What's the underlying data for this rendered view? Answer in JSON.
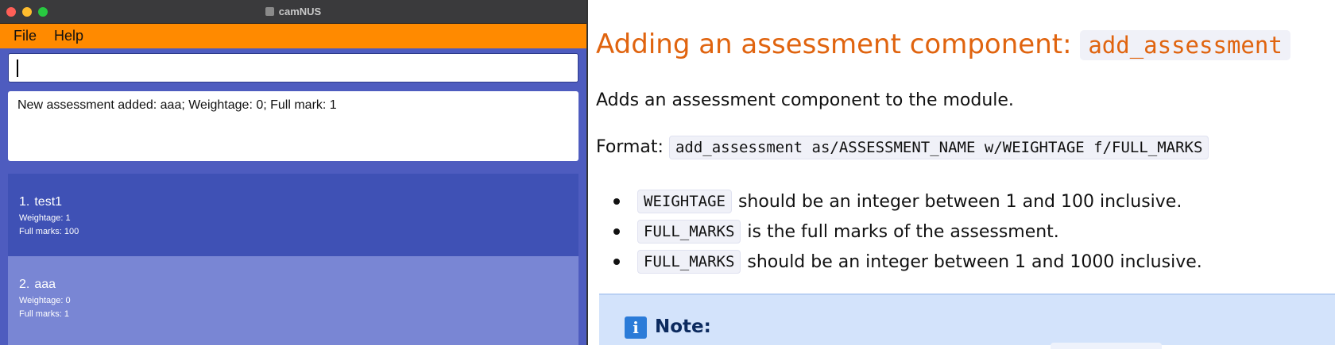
{
  "app": {
    "window_title": "camNUS",
    "menu": [
      "File",
      "Help"
    ],
    "command_input": {
      "value": "",
      "placeholder": ""
    },
    "result_text": "New assessment added: aaa; Weightage: 0; Full mark: 1",
    "assessments": [
      {
        "index": "1.",
        "name": "test1",
        "weightage": "Weightage: 1",
        "full_marks": "Full marks: 100"
      },
      {
        "index": "2.",
        "name": "aaa",
        "weightage": "Weightage: 0",
        "full_marks": "Full marks: 1"
      }
    ],
    "colors": {
      "menubar": "#ff8a00",
      "panel": "#4e5cbf",
      "card_selected": "#3f51b5",
      "card": "#7986d4"
    }
  },
  "doc": {
    "heading_text": "Adding an assessment component: ",
    "heading_code": "add_assessment",
    "description": "Adds an assessment component to the module.",
    "format_label": "Format:",
    "format_code": "add_assessment as/ASSESSMENT_NAME w/WEIGHTAGE f/FULL_MARKS",
    "bullets": [
      {
        "code": "WEIGHTAGE",
        "text": "should be an integer between 1 and 100 inclusive."
      },
      {
        "code": "FULL_MARKS",
        "text": "is the full marks of the assessment."
      },
      {
        "code": "FULL_MARKS",
        "text": "should be an integer between 1 and 1000 inclusive."
      }
    ],
    "note_label": "Note:",
    "note_icon": "info-icon",
    "colors": {
      "heading": "#e0640f",
      "note_bg": "#d3e3fb"
    }
  }
}
